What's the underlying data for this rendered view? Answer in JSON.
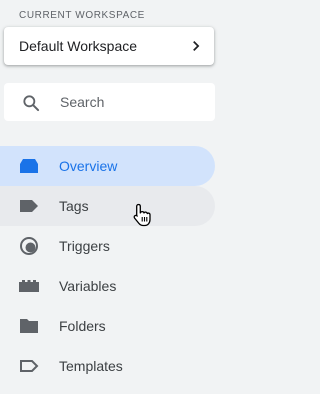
{
  "workspace": {
    "section_label": "CURRENT WORKSPACE",
    "name": "Default Workspace"
  },
  "search": {
    "placeholder": "Search",
    "value": ""
  },
  "nav": {
    "items": [
      {
        "label": "Overview",
        "icon": "overview-icon",
        "state": "active"
      },
      {
        "label": "Tags",
        "icon": "tag-icon",
        "state": "hover"
      },
      {
        "label": "Triggers",
        "icon": "triggers-icon",
        "state": "normal"
      },
      {
        "label": "Variables",
        "icon": "variables-icon",
        "state": "normal"
      },
      {
        "label": "Folders",
        "icon": "folder-icon",
        "state": "normal"
      },
      {
        "label": "Templates",
        "icon": "templates-icon",
        "state": "normal"
      }
    ]
  },
  "colors": {
    "background": "#f1f3f4",
    "active_bg": "#d2e3fc",
    "active_fg": "#1a73e8",
    "hover_bg": "#e8eaed",
    "icon": "#5f6368"
  }
}
